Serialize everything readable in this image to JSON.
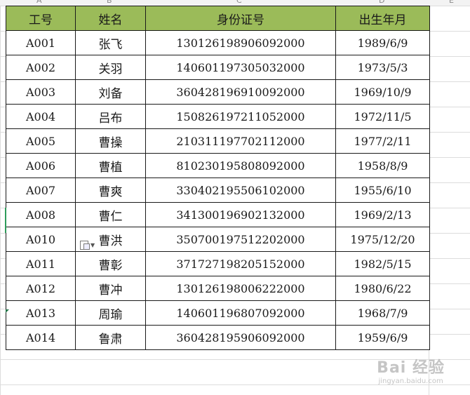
{
  "column_letters": [
    "A",
    "B",
    "C",
    "D",
    "E"
  ],
  "table": {
    "headers": [
      "工号",
      "姓名",
      "身份证号",
      "出生年月"
    ],
    "rows": [
      [
        "A001",
        "张飞",
        "130126198906092000",
        "1989/6/9"
      ],
      [
        "A002",
        "关羽",
        "140601197305032000",
        "1973/5/3"
      ],
      [
        "A003",
        "刘备",
        "360428196910092000",
        "1969/10/9"
      ],
      [
        "A004",
        "吕布",
        "150826197211052000",
        "1972/11/5"
      ],
      [
        "A005",
        "曹操",
        "210311197702112000",
        "1977/2/11"
      ],
      [
        "A006",
        "曹植",
        "810230195808092000",
        "1958/8/9"
      ],
      [
        "A007",
        "曹爽",
        "330402195506102000",
        "1955/6/10"
      ],
      [
        "A008",
        "曹仁",
        "341300196902132000",
        "1969/2/13"
      ],
      [
        "A010",
        "曹洪",
        "350700197512202000",
        "1975/12/20"
      ],
      [
        "A011",
        "曹彰",
        "371727198205152000",
        "1982/5/15"
      ],
      [
        "A012",
        "曹冲",
        "130126198006222000",
        "1980/6/22"
      ],
      [
        "A013",
        "周瑜",
        "140601196807092000",
        "1968/7/9"
      ],
      [
        "A014",
        "鲁肃",
        "360428195906092000",
        "1959/6/9"
      ]
    ]
  },
  "colors": {
    "header_fill": "#9bbb59",
    "border": "#1a1a1a",
    "gridline": "#dcdcdc"
  },
  "icons": {
    "paste_options": "paste-options-icon"
  },
  "watermark": {
    "main": "Bai 经验",
    "sub": "jingyan.baidu.com"
  }
}
